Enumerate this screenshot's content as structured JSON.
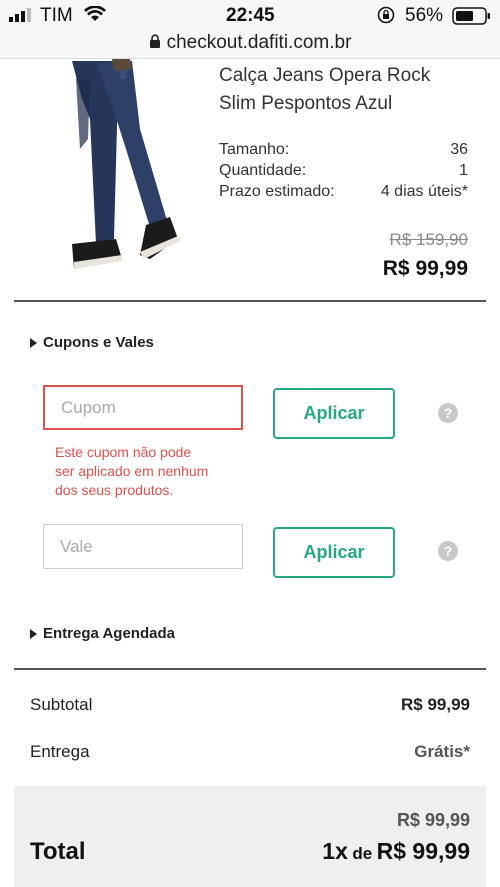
{
  "status_bar": {
    "carrier": "TIM",
    "time": "22:45",
    "battery": "56%",
    "url": "checkout.dafiti.com.br"
  },
  "product": {
    "name_line1": "Calça Jeans Opera Rock",
    "name_line2": "Slim Pespontos Azul",
    "size_label": "Tamanho:",
    "size_value": "36",
    "qty_label": "Quantidade:",
    "qty_value": "1",
    "eta_label": "Prazo estimado:",
    "eta_value": "4 dias úteis*",
    "old_price": "R$ 159,90",
    "price": "R$ 99,99"
  },
  "coupons": {
    "title": "Cupons e Vales",
    "coupon_placeholder": "Cupom",
    "apply_label": "Aplicar",
    "error_line1": "Este cupom não pode",
    "error_line2": "ser aplicado em nenhum",
    "error_line3": "dos seus produtos.",
    "voucher_placeholder": "Vale",
    "help_glyph": "?"
  },
  "scheduled": {
    "title": "Entrega Agendada"
  },
  "summary": {
    "subtotal_label": "Subtotal",
    "subtotal_value": "R$ 99,99",
    "shipping_label": "Entrega",
    "shipping_value": "Grátis*",
    "total_label": "Total",
    "total_price": "R$ 99,99",
    "installments_count": "1x",
    "installments_de": "de",
    "installments_value": "R$ 99,99"
  },
  "colors": {
    "accent": "#29a77e",
    "error": "#d9534f"
  }
}
